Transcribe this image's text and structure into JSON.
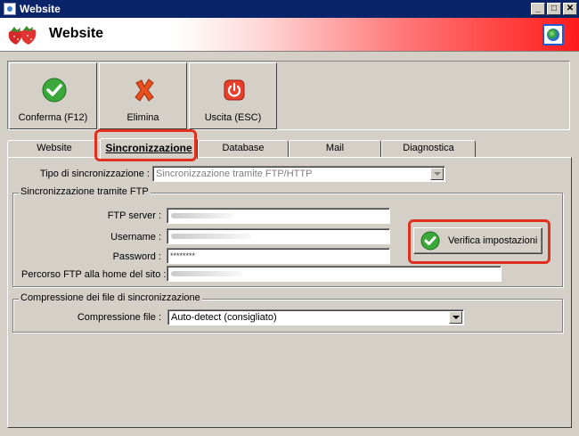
{
  "window": {
    "title": "Website",
    "minimize_label": "_",
    "maximize_label": "□",
    "close_label": "✕"
  },
  "header": {
    "title": "Website"
  },
  "toolbar": {
    "confirm_label": "Conferma (F12)",
    "delete_label": "Elimina",
    "exit_label": "Uscita (ESC)"
  },
  "tabs": [
    {
      "label": "Website"
    },
    {
      "label": "Sincronizzazione"
    },
    {
      "label": "Database"
    },
    {
      "label": "Mail"
    },
    {
      "label": "Diagnostica"
    }
  ],
  "sync": {
    "type_label": "Tipo di sincronizzazione :",
    "type_value": "Sincronizzazione tramite FTP/HTTP",
    "ftp_group_title": "Sincronizzazione tramite FTP",
    "ftp_server_label": "FTP server :",
    "username_label": "Username :",
    "password_label": "Password :",
    "password_value": "********",
    "path_label": "Percorso FTP alla home del sito :",
    "verify_button_label": "Verifica impostazioni",
    "compression_group_title": "Compressione dei file di sincronizzazione",
    "compression_label": "Compressione file :",
    "compression_value": "Auto-detect (consigliato)"
  },
  "colors": {
    "window_bg": "#d4d0c8",
    "titlebar": "#0a246a",
    "highlight": "#e0301e"
  }
}
